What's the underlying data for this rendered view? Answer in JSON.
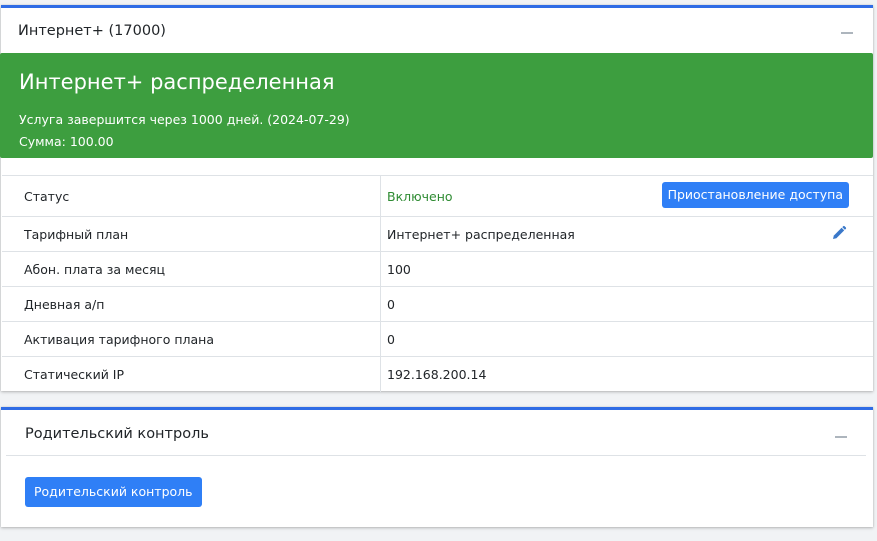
{
  "service_card": {
    "title": "Интернет+ (17000)",
    "banner": {
      "title": "Интернет+ распределенная",
      "expires_text": "Услуга завершится через 1000 дней. (2024-07-29)",
      "sum_text": "Сумма: 100.00",
      "color": "#3d9e3f"
    },
    "rows": [
      {
        "label": "Статус",
        "value": "Включено"
      },
      {
        "label": "Тарифный план",
        "value": "Интернет+ распределенная"
      },
      {
        "label": "Абон. плата за месяц",
        "value": "100"
      },
      {
        "label": "Дневная а/п",
        "value": "0"
      },
      {
        "label": "Активация тарифного плана",
        "value": "0"
      },
      {
        "label": "Статический IP",
        "value": "192.168.200.14"
      }
    ],
    "suspend_button": "Приостановление доступа",
    "edit_icon": "pencil-icon"
  },
  "parental_card": {
    "title": "Родительский контроль",
    "button": "Родительский контроль"
  },
  "colors": {
    "accent": "#2f6ce5",
    "button": "#2f7ff6",
    "status_on": "#2e8b32"
  }
}
